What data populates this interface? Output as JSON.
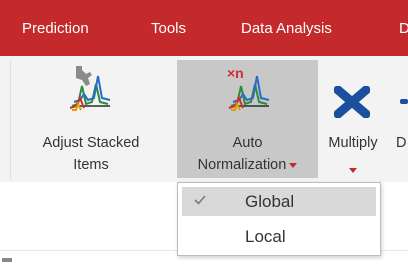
{
  "menubar": {
    "items": [
      {
        "label": "Prediction"
      },
      {
        "label": "Tools"
      },
      {
        "label": "Data Analysis"
      },
      {
        "label": "D"
      }
    ],
    "color": "#c42a2b"
  },
  "ribbon": {
    "adjust_stacked": {
      "line1": "Adjust Stacked",
      "line2": "Items",
      "icon": "adjust-stacked-spectra-icon"
    },
    "auto_normalization": {
      "line1": "Auto",
      "line2": "Normalization",
      "icon": "auto-normalization-icon"
    },
    "multiply": {
      "label": "Multiply",
      "icon": "multiply-icon"
    },
    "next_partial": {
      "label": "D"
    }
  },
  "dropdown": {
    "options": [
      {
        "label": "Global",
        "selected": true
      },
      {
        "label": "Local",
        "selected": false
      }
    ]
  }
}
